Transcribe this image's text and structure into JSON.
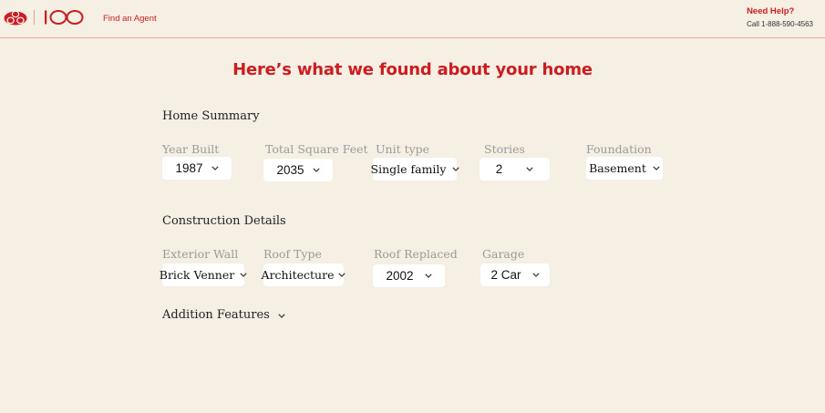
{
  "header": {
    "logo_text": "100",
    "find_agent_label": "Find an Agent",
    "help_title": "Need Help?",
    "help_phone": "Call 1-888-590-4563"
  },
  "page_title": "Here’s what we found about your home",
  "home_summary": {
    "title": "Home Summary",
    "fields": [
      {
        "label": "Year Built",
        "value": "1987"
      },
      {
        "label": "Total Square Feet",
        "value": "2035"
      },
      {
        "label": "Unit type",
        "value": "Single family"
      },
      {
        "label": "Stories",
        "value": "2"
      },
      {
        "label": "Foundation",
        "value": "Basement"
      }
    ]
  },
  "construction": {
    "title": "Construction Details",
    "fields": [
      {
        "label": "Exterior Wall",
        "value": "Brick Venner"
      },
      {
        "label": "Roof Type",
        "value": "Architecture"
      },
      {
        "label": "Roof Replaced",
        "value": "2002"
      },
      {
        "label": "Garage",
        "value": "2 Car"
      }
    ]
  },
  "addition_features_label": "Addition Features",
  "colors": {
    "brand_red": "#cc1d20",
    "background": "#f5efe4",
    "label_gray": "#9b9b9b"
  },
  "icons": [
    "state-farm-logo-icon",
    "chevron-down-icon"
  ]
}
